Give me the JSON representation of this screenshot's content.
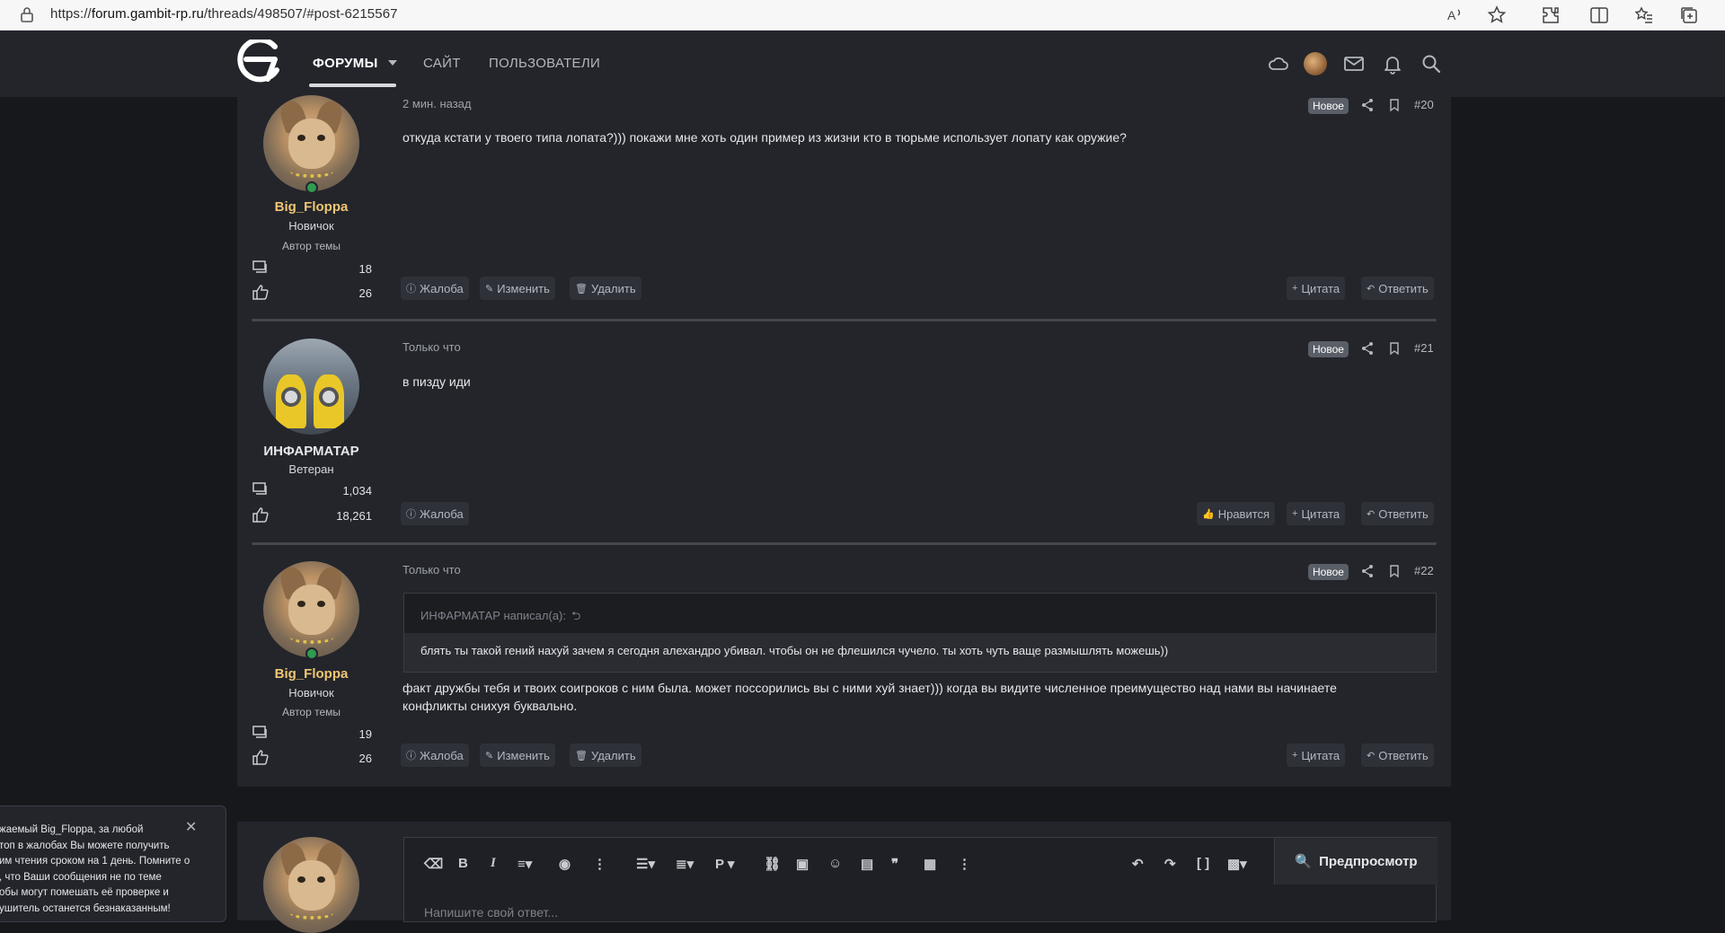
{
  "browser": {
    "url_prefix": "https://",
    "url_host": "forum.gambit-rp.ru",
    "url_path": "/threads/498507/#post-6215567",
    "icons": [
      "lock-icon",
      "read-aloud-icon",
      "favorite-star-icon",
      "extensions-icon",
      "split-screen-icon",
      "favorites-icon",
      "collections-icon"
    ]
  },
  "nav": {
    "tabs": [
      {
        "label": "ФОРУМЫ",
        "active": true
      },
      {
        "label": "САЙТ",
        "active": false
      },
      {
        "label": "ПОЛЬЗОВАТЕЛИ",
        "active": false
      }
    ]
  },
  "posts": [
    {
      "user": "Big_Floppa",
      "title": "Новичок",
      "banner": "Автор темы",
      "messages": "18",
      "reactions": "26",
      "time": "2 мин. назад",
      "badge": "Новое",
      "number": "#20",
      "text": "откуда кстати у твоего типа лопата?))) покажи мне хоть один пример из жизни кто в тюрьме использует лопату как оружие?",
      "actions_left": [
        "Жалоба",
        "Изменить",
        "Удалить"
      ],
      "actions_right": [
        "Цитата",
        "Ответить"
      ]
    },
    {
      "user": "ИНФАРМАТАР",
      "title": "Ветеран",
      "messages": "1,034",
      "reactions": "18,261",
      "time": "Только что",
      "badge": "Новое",
      "number": "#21",
      "text": "в пизду иди",
      "actions_left": [
        "Жалоба"
      ],
      "actions_right": [
        "Нравится",
        "Цитата",
        "Ответить"
      ]
    },
    {
      "user": "Big_Floppa",
      "title": "Новичок",
      "banner": "Автор темы",
      "messages": "19",
      "reactions": "26",
      "time": "Только что",
      "badge": "Новое",
      "number": "#22",
      "quote_header": "ИНФАРМАТАР написал(а):",
      "quote_text": "блять ты такой гений нахуй зачем я сегодня алехандро убивал. чтобы он не флешился чучело. ты хоть чуть ваще размышлять можешь))",
      "text_line1": "факт дружбы тебя и твоих соигроков с ним была. может поссорились вы с ними хуй знает))) когда вы видите численное преимущество над нами вы начинаете",
      "text_line2": "конфликты снихуя буквально.",
      "actions_left": [
        "Жалоба",
        "Изменить",
        "Удалить"
      ],
      "actions_right": [
        "Цитата",
        "Ответить"
      ]
    }
  ],
  "editor": {
    "preview_label": "Предпросмотр",
    "placeholder": "Напишите свой ответ..."
  },
  "toast": {
    "lines": [
      "жаемый Big_Floppa, за любой",
      "топ в жалобах Вы можете получить",
      "им чтения сроком на 1 день. Помните о",
      ", что Ваши сообщения не по теме",
      "обы могут помешать её проверке и",
      "ушитель останется безнаказанным!"
    ]
  },
  "colors": {
    "bg": "#17181c",
    "panel": "#23252b",
    "username": "#f0c674",
    "online": "#2f9c4f"
  }
}
